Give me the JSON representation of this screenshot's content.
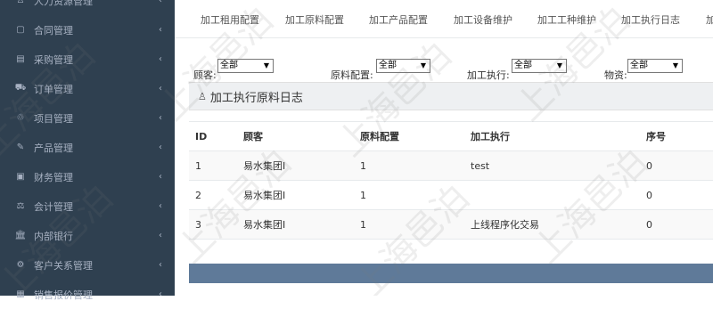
{
  "sidebar": {
    "items": [
      {
        "label": "人力资源管理",
        "icon": "people-icon"
      },
      {
        "label": "合同管理",
        "icon": "contract-icon"
      },
      {
        "label": "采购管理",
        "icon": "purchase-icon"
      },
      {
        "label": "订单管理",
        "icon": "cart-icon"
      },
      {
        "label": "项目管理",
        "icon": "project-icon"
      },
      {
        "label": "产品管理",
        "icon": "edit-icon"
      },
      {
        "label": "财务管理",
        "icon": "finance-icon"
      },
      {
        "label": "会计管理",
        "icon": "scale-icon"
      },
      {
        "label": "内部银行",
        "icon": "bank-icon"
      },
      {
        "label": "客户关系管理",
        "icon": "gears-icon"
      },
      {
        "label": "销售报价管理",
        "icon": "quote-icon"
      }
    ]
  },
  "tabs": [
    "加工租用配置",
    "加工原料配置",
    "加工产品配置",
    "加工设备维护",
    "加工工种维护",
    "加工执行日志",
    "加"
  ],
  "filters": {
    "customer": {
      "label": "顾客:",
      "value": "全部"
    },
    "material": {
      "label": "原料配置:",
      "value": "全部"
    },
    "execution": {
      "label": "加工执行:",
      "value": "全部"
    },
    "resource": {
      "label": "物资:",
      "value": "全部"
    }
  },
  "panel": {
    "title": "加工执行原料日志"
  },
  "table": {
    "headers": [
      "ID",
      "顾客",
      "原料配置",
      "加工执行",
      "序号"
    ],
    "rows": [
      [
        "1",
        "易水集团I",
        "1",
        "test",
        "0"
      ],
      [
        "2",
        "易水集团I",
        "1",
        "",
        "0"
      ],
      [
        "3",
        "易水集团I",
        "1",
        "上线程序化交易",
        "0"
      ]
    ]
  },
  "watermark": "上海邑泊"
}
